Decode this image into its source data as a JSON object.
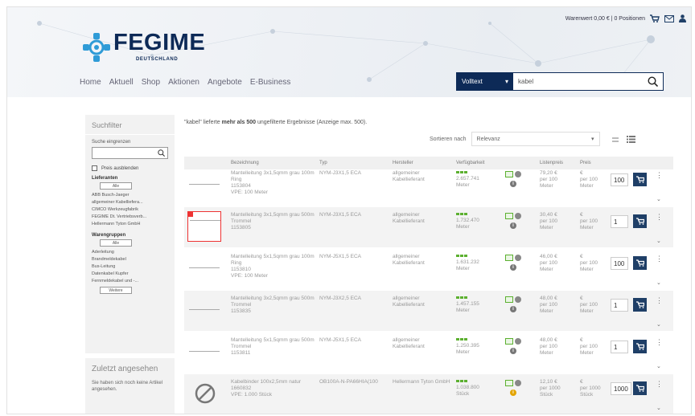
{
  "topbar": {
    "cart_text": "Warenwert 0,00 € | 0 Positionen"
  },
  "logo": {
    "word": "FEGIME",
    "sub": "DEUTSCHLAND"
  },
  "nav": [
    "Home",
    "Aktuell",
    "Shop",
    "Aktionen",
    "Angebote",
    "E-Business"
  ],
  "search": {
    "mode": "Volltext",
    "value": "kabel"
  },
  "sidebar": {
    "title": "Suchfilter",
    "narrow_label": "Suche eingrenzen",
    "hide_prices": "Preis ausblenden",
    "suppliers_heading": "Lieferanten",
    "all_label": "Alle",
    "suppliers": [
      "ABB Busch-Jaeger",
      "allgemeiner Kabellieferа...",
      "CIMCO Werkzeugfabrik",
      "FEGIME Dt. Vertriebsverb...",
      "Hellermann Tyton GmbH"
    ],
    "groups_heading": "Warengruppen",
    "groups": [
      "Aderleitung",
      "Brandmeldekabel",
      "Bus-Leitung",
      "Datenkabel Kupfer",
      "Fernmeldekabel und -..."
    ],
    "more_label": "Weitere",
    "recent_title": "Zuletzt angesehen",
    "recent_text": "Sie haben sich noch keine Artikel angesehen."
  },
  "results": {
    "query": "\"kabel\"",
    "text": " lieferte ",
    "bold": "mehr als 500",
    "tail": " ungefilterte Ergebnisse (Anzeige max. 500)."
  },
  "sort": {
    "label": "Sortieren nach",
    "value": "Relevanz"
  },
  "columns": [
    "Bezeichnung",
    "Typ",
    "Hersteller",
    "Verfügbarkeit",
    "Listenpreis",
    "Preis"
  ],
  "rows": [
    {
      "name": "Mantelleitung 3x1,5qmm grau 100m Ring",
      "num": "1153804",
      "ve": "VPE: 100 Meter",
      "type": "NYM-J3X1,5 ECA",
      "maker": "allgemeiner Kabellieferant",
      "stock": "2.657.741",
      "unit": "Meter",
      "list": "79,20 €",
      "per": "per 100",
      "unit2": "Meter",
      "price": "€",
      "pper": "per 100",
      "punit": "Meter",
      "qty": "100"
    },
    {
      "name": "Mantelleitung 3x1,5qmm grau 500m Trommel",
      "num": "1153805",
      "ve": "",
      "type": "NYM-J3X1,5 ECA",
      "maker": "allgemeiner Kabellieferant",
      "stock": "1.732.470",
      "unit": "Meter",
      "list": "30,40 €",
      "per": "per 100",
      "unit2": "Meter",
      "price": "€",
      "pper": "per 100",
      "punit": "Meter",
      "qty": "1"
    },
    {
      "name": "Mantelleitung 5x1,5qmm grau 100m Ring",
      "num": "1153810",
      "ve": "VPE: 100 Meter",
      "type": "NYM-J5X1,5 ECA",
      "maker": "allgemeiner Kabellieferant",
      "stock": "1.631.232",
      "unit": "Meter",
      "list": "46,00 €",
      "per": "per 100",
      "unit2": "Meter",
      "price": "€",
      "pper": "per 100",
      "punit": "Meter",
      "qty": "100"
    },
    {
      "name": "Mantelleitung 3x2,5qmm grau 500m Trommel",
      "num": "1153835",
      "ve": "",
      "type": "NYM-J3X2,5 ECA",
      "maker": "allgemeiner Kabellieferant",
      "stock": "1.457.155",
      "unit": "Meter",
      "list": "48,00 €",
      "per": "per 100",
      "unit2": "Meter",
      "price": "€",
      "pper": "per 100",
      "punit": "Meter",
      "qty": "1"
    },
    {
      "name": "Mantelleitung 5x1,5qmm grau 500m Trommel",
      "num": "1153811",
      "ve": "",
      "type": "NYM-J5X1,5 ECA",
      "maker": "allgemeiner Kabellieferant",
      "stock": "1.250.395",
      "unit": "Meter",
      "list": "48,00 €",
      "per": "per 100",
      "unit2": "Meter",
      "price": "€",
      "pper": "per 100",
      "punit": "Meter",
      "qty": "1"
    },
    {
      "name": "Kabelbinder 100x2,5mm natur",
      "num": "1660832",
      "ve": "VPE: 1.000 Stück",
      "type": "OB100A-N-PA66HIA(100",
      "maker": "Hellermann Tyton GmbH",
      "stock": "1.038.800",
      "unit": "Stück",
      "list": "12,10 €",
      "per": "per 1000",
      "unit2": "Stück",
      "price": "€",
      "pper": "per 1000",
      "punit": "Stück",
      "qty": "1000"
    }
  ]
}
